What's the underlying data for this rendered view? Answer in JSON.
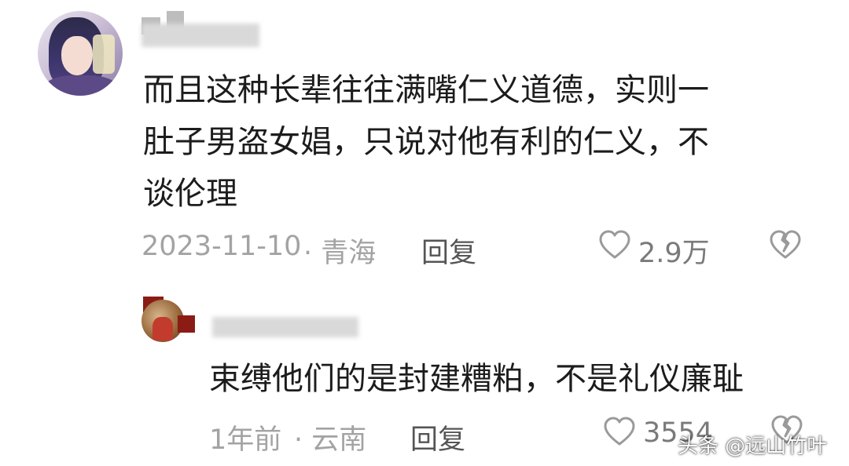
{
  "comments": [
    {
      "text_lines": [
        "而且这种长辈往往满嘴仁义道德，实则一",
        "肚子男盗女娼，只说对他有利的仁义，不",
        "谈伦理"
      ],
      "date": "2023-11-10",
      "location": "· 青海",
      "reply_label": "回复",
      "like_count": "2.9万"
    },
    {
      "text_lines": [
        "束缚他们的是封建糟粕，不是礼仪廉耻"
      ],
      "date": "1年前",
      "location": "· 云南",
      "reply_label": "回复",
      "like_count": "3554"
    }
  ],
  "watermark": "头条 @远山竹叶",
  "colors": {
    "text": "#1c1c1c",
    "meta": "#a3a3a3",
    "icon": "#9a9a9a"
  },
  "icons": {
    "like": "heart-outline-icon",
    "dislike": "broken-heart-outline-icon"
  }
}
